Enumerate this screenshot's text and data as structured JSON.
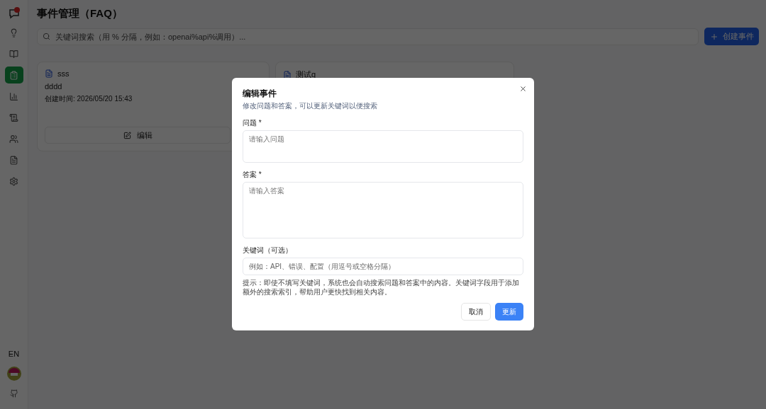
{
  "page": {
    "title": "事件管理（FAQ）",
    "search": {
      "placeholder": "关键词搜索（用 % 分隔，例如：openai%api%调用）..."
    },
    "create_button": "创建事件"
  },
  "sidebar": {
    "items": [
      {
        "selected": false
      },
      {
        "selected": false
      },
      {
        "selected": true
      },
      {
        "selected": false
      },
      {
        "selected": false
      },
      {
        "selected": false
      },
      {
        "selected": false
      },
      {
        "selected": false
      }
    ],
    "language": "EN"
  },
  "cards": [
    {
      "title": "sss",
      "body": "dddd",
      "created": "创建时间: 2026/05/20 15:43",
      "edit": "编辑"
    },
    {
      "title": "测试q"
    }
  ],
  "dialog": {
    "title": "编辑事件",
    "description": "修改问题和答案，可以更新关键词以便搜索",
    "fields": [
      {
        "kind": "short_text",
        "label": "问题 *",
        "placeholder": "请输入问题"
      },
      {
        "kind": "long_text",
        "label": "答案 *",
        "placeholder": "请输入答案"
      },
      {
        "kind": "input",
        "label": "关键词（可选）",
        "placeholder": "例如：API、错误、配置（用逗号或空格分隔）"
      }
    ],
    "hint": "提示：即使不填写关键词，系统也会自动搜索问题和答案中的内容。关键词字段用于添加额外的搜索索引，帮助用户更快找到相关内容。",
    "buttons": [
      {
        "kind": "secondary",
        "label": "取消"
      },
      {
        "kind": "primary",
        "label": "更新"
      }
    ]
  }
}
